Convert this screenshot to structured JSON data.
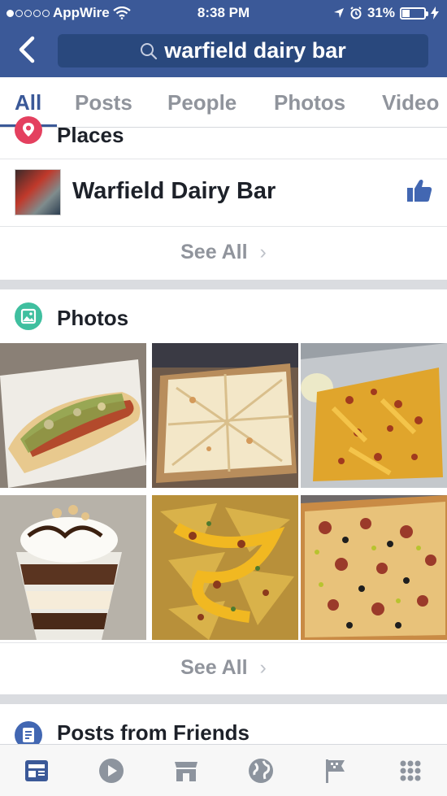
{
  "status_bar": {
    "carrier": "AppWire",
    "time": "8:38 PM",
    "battery": "31%"
  },
  "search": {
    "query": "warfield dairy bar"
  },
  "tabs": [
    {
      "label": "All",
      "active": true
    },
    {
      "label": "Posts",
      "active": false
    },
    {
      "label": "People",
      "active": false
    },
    {
      "label": "Photos",
      "active": false
    },
    {
      "label": "Video",
      "active": false
    }
  ],
  "places": {
    "title": "Places",
    "result": {
      "name": "Warfield Dairy Bar",
      "liked": true
    },
    "see_all": "See All"
  },
  "photos": {
    "title": "Photos",
    "items": [
      {
        "name": "hot-dog-photo"
      },
      {
        "name": "flatbread-pizza-photo"
      },
      {
        "name": "loaded-fries-photo"
      },
      {
        "name": "sundae-photo"
      },
      {
        "name": "nachos-photo"
      },
      {
        "name": "pizza-photo"
      }
    ],
    "see_all": "See All"
  },
  "posts_from_friends": {
    "title": "Posts from Friends"
  },
  "bottom_nav": [
    {
      "icon": "news-feed-icon",
      "active": true
    },
    {
      "icon": "video-play-icon",
      "active": false
    },
    {
      "icon": "marketplace-icon",
      "active": false
    },
    {
      "icon": "globe-notifications-icon",
      "active": false
    },
    {
      "icon": "pages-flag-icon",
      "active": false
    },
    {
      "icon": "menu-grid-icon",
      "active": false
    }
  ],
  "colors": {
    "brand_blue": "#3b5998",
    "search_bg": "#29487d",
    "tab_inactive": "#90949c",
    "places_pin": "#e4405f",
    "photos_icon": "#3fbf9f",
    "posts_icon": "#4267b2"
  }
}
